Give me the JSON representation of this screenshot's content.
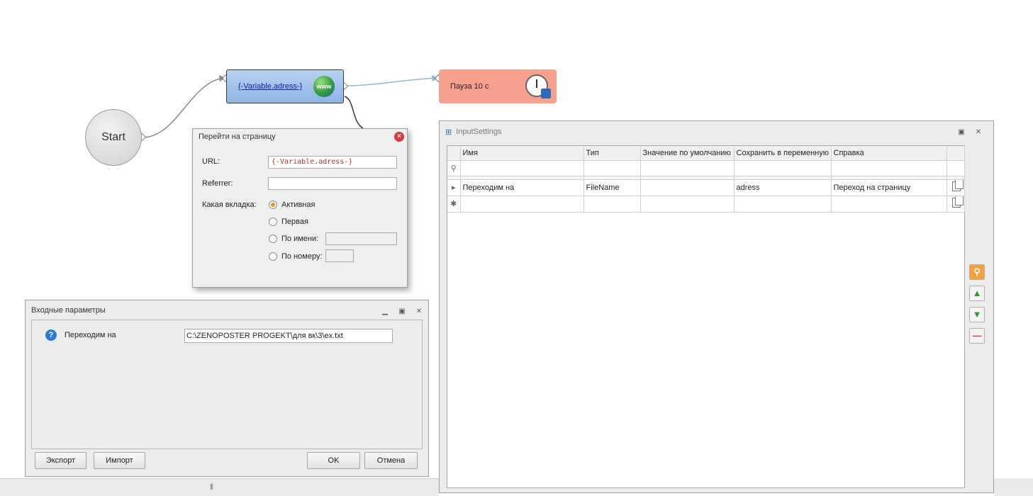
{
  "canvas": {
    "start_label": "Start",
    "navigate_node_label": "{-Variable.adress-}",
    "pause_node_label": "Пауза 10 с"
  },
  "navigate_dialog": {
    "title": "Перейти на страницу",
    "url_label": "URL:",
    "url_value": "{-Variable.adress-}",
    "referrer_label": "Referrer:",
    "referrer_value": "",
    "tab_label": "Какая вкладка:",
    "options": [
      "Активная",
      "Первая",
      "По имени:",
      "По номеру:"
    ],
    "selected": "Активная"
  },
  "input_params": {
    "title": "Входные параметры",
    "param_label": "Переходим на",
    "param_value": "C:\\ZENOPOSTER PROGEKT\\для вк\\3\\ex.txt",
    "export_label": "Экспорт",
    "import_label": "Импорт",
    "ok_label": "OK",
    "cancel_label": "Отмена"
  },
  "input_settings": {
    "title": "InputSettings",
    "columns": [
      "Имя",
      "Тип",
      "Значение по умолчанию",
      "Сохранить в переменную",
      "Справка"
    ],
    "rows": [
      {
        "name": "Переходим на",
        "type": "FileName",
        "default": "",
        "save_to": "adress",
        "help": "Переход на страницу"
      }
    ]
  },
  "icons": [
    "www-globe-icon",
    "stopwatch-icon",
    "close-icon",
    "help-icon",
    "search-icon",
    "arrow-up-icon",
    "arrow-down-icon",
    "minus-icon",
    "copy-icon"
  ],
  "colors": {
    "navigate_node": "#8fb4e3",
    "pause_node": "#f7a08e",
    "selected_radio": "#e09a1a"
  }
}
